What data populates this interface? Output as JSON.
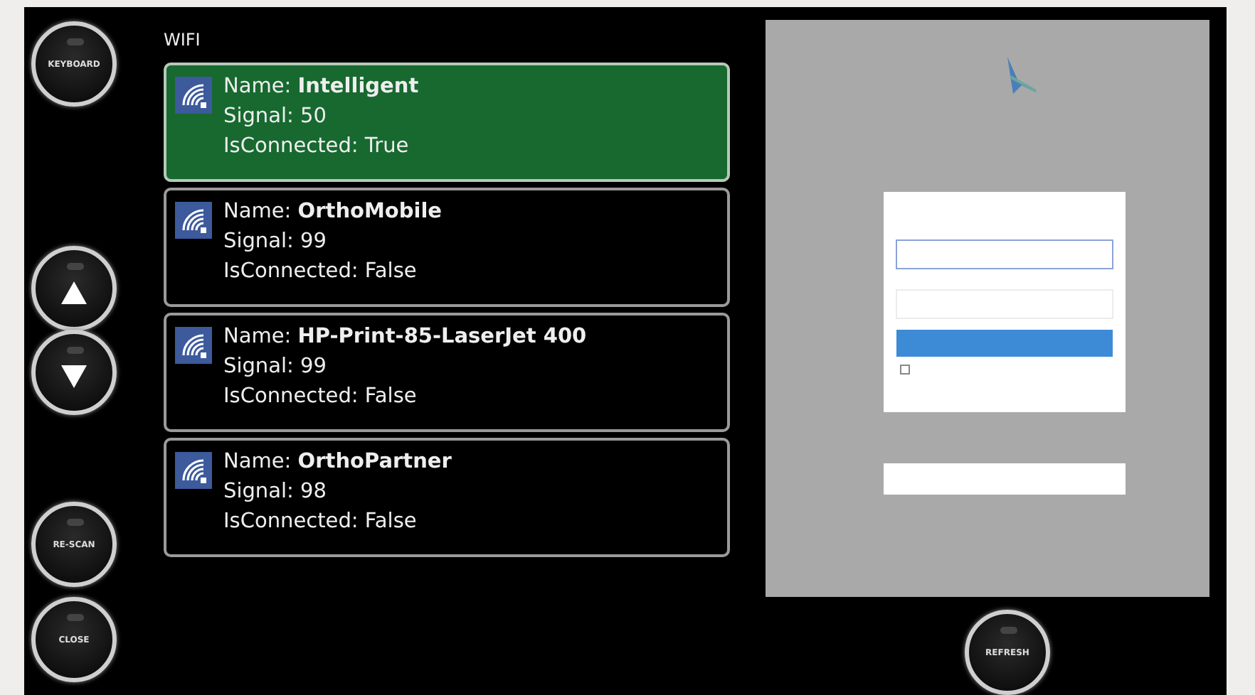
{
  "left_buttons": [
    {
      "kind": "text",
      "label": "KEYBOARD"
    },
    {
      "kind": "up"
    },
    {
      "kind": "down"
    },
    {
      "kind": "text",
      "label": "RE-SCAN"
    },
    {
      "kind": "text",
      "label": "CLOSE"
    }
  ],
  "title": "WIFI",
  "networks": [
    {
      "name": "Name: **Intelligent**",
      "signal": "Signal: 50",
      "connected": "IsConnected: True",
      "selected": true
    },
    {
      "name": "Name: **OrthoMobile**",
      "signal": "Signal: 99",
      "connected": "IsConnected: False",
      "selected": false
    },
    {
      "name": "Name: **HP-Print-85-LaserJet 400**",
      "signal": "Signal: 99",
      "connected": "IsConnected: False",
      "selected": false
    },
    {
      "name": "Name: **OrthoPartner**",
      "signal": "Signal: 98",
      "connected": "IsConnected: False",
      "selected": false
    }
  ],
  "login": {
    "remember_checked": false
  },
  "refresh_button": {
    "label": "REFRESH"
  }
}
